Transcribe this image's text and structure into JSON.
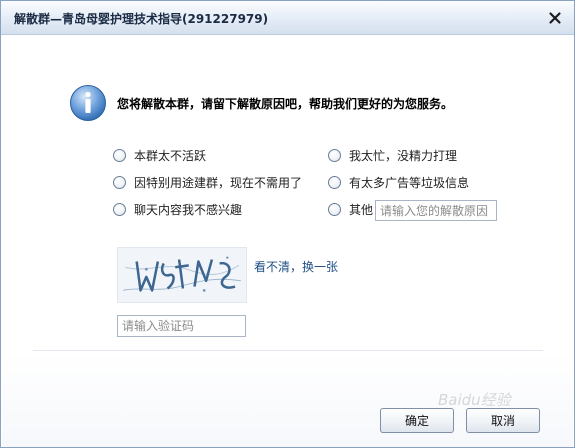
{
  "window": {
    "title": "解散群—青岛母婴护理技术指导(291227979)"
  },
  "prompt": {
    "text": "您将解散本群，请留下解散原因吧，帮助我们更好的为您服务。"
  },
  "reasons": {
    "r1": "本群太不活跃",
    "r2": "因特别用途建群，现在不需用了",
    "r3": "聊天内容我不感兴趣",
    "r4": "我太忙，没精力打理",
    "r5": "有太多广告等垃圾信息",
    "r6": "其他"
  },
  "other_reason": {
    "placeholder": "请输入您的解散原因"
  },
  "captcha": {
    "refresh_label": "看不清，换一张"
  },
  "verify": {
    "placeholder": "请输入验证码"
  },
  "buttons": {
    "ok": "确定",
    "cancel": "取消"
  },
  "watermark": {
    "text": "Baidu经验"
  },
  "colors": {
    "titlebar": "#dbe5f2",
    "link": "#1f4f86",
    "info_icon": "#4a86c8"
  },
  "icons": {
    "info": "info-icon",
    "close": "close-icon"
  }
}
